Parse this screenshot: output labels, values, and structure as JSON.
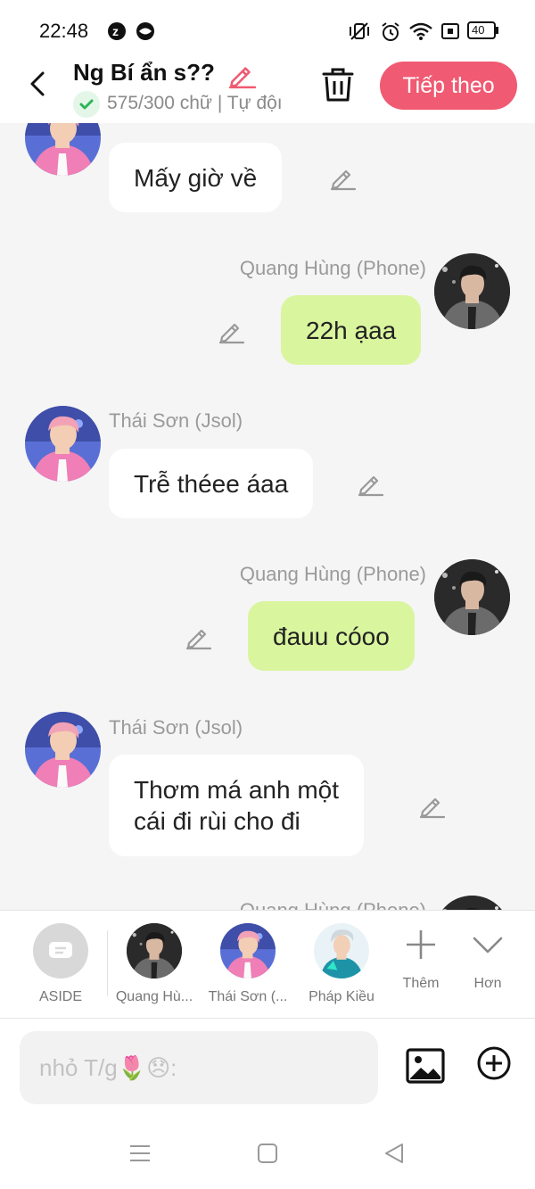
{
  "status_bar": {
    "time": "22:48",
    "battery": "40",
    "icons": [
      "app-z-icon",
      "app-circle-icon",
      "vibrate-off-icon",
      "alarm-icon",
      "wifi-icon",
      "screen-record-icon",
      "battery-icon"
    ]
  },
  "header": {
    "title": "Ng Bí ẩn s??",
    "subtitle": "575/300 chữ | Tự độı",
    "next_button": "Tiếp theo"
  },
  "messages": [
    {
      "sender": "Thái Sơn (Jsol)",
      "text": "Mấy giờ về",
      "side": "in",
      "sender_shown": false
    },
    {
      "sender": "Quang Hùng (Phone)",
      "text": "22h ạaa",
      "side": "out"
    },
    {
      "sender": "Thái Sơn (Jsol)",
      "text": "Trễ théee áaa",
      "side": "in"
    },
    {
      "sender": "Quang Hùng (Phone)",
      "text": "đauu cóoo",
      "side": "out"
    },
    {
      "sender": "Thái Sơn (Jsol)",
      "text_line1": "Thơm má anh một",
      "text_line2": "cái đi rùi cho đi",
      "side": "in"
    },
    {
      "sender": "Quang Hùng (Phone)",
      "side": "out",
      "partial": true
    }
  ],
  "characters": {
    "aside": "ASIDE",
    "items": [
      "Quang Hù...",
      "Thái Sơn (...",
      "Pháp Kiều"
    ],
    "add_label": "Thêm",
    "more_label": "Hơn"
  },
  "input": {
    "placeholder": "nhỏ T/g🌷😞:"
  },
  "colors": {
    "accent": "#f05a72",
    "outgoing_bubble": "#d9f59e",
    "incoming_bubble": "#ffffff",
    "background": "#f5f5f5"
  }
}
